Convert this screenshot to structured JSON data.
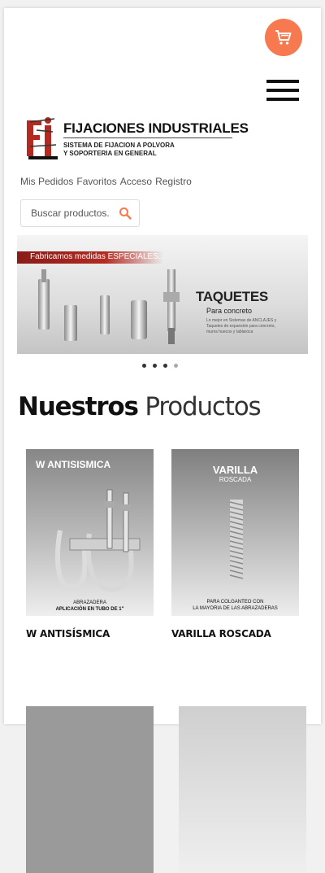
{
  "header": {
    "logo": {
      "title": "FIJACIONES INDUSTRIALES",
      "subtitle_line1": "SISTEMA DE FIJACION A POLVORA",
      "subtitle_line2": "Y SOPORTERIA EN GENERAL"
    }
  },
  "user_nav": [
    "Mis Pedidos",
    "Favoritos",
    "Acceso",
    "Registro"
  ],
  "search": {
    "placeholder": "Buscar productos..."
  },
  "slider": {
    "banner_text": "Fabricamos medidas ESPECIALES...",
    "title": "TAQUETES",
    "subtitle": "Para concreto",
    "description": "Lo mejor en Sistemas de ANCLAJES y Taquetes de expansión para concreto, muros huecos y tablaroca",
    "dots_total": 4,
    "active_dot": 4
  },
  "section": {
    "title_bold": "Nuestros",
    "title_light": "Productos"
  },
  "products": [
    {
      "name": "W ANTISÍSMICA",
      "image_title": "W ANTISISMICA",
      "image_caption_1": "ABRAZADERA",
      "image_caption_2": "APLICACIÓN EN TUBO DE 1\""
    },
    {
      "name": "VARILLA ROSCADA",
      "image_title": "VARILLA",
      "image_subtitle": "ROSCADA",
      "image_caption_1": "PARA COLGANTEO CON",
      "image_caption_2": "LA MAYORIA DE LAS ABRAZADERAS"
    }
  ],
  "colors": {
    "accent": "#f7794f",
    "brand_red": "#b32a22"
  }
}
